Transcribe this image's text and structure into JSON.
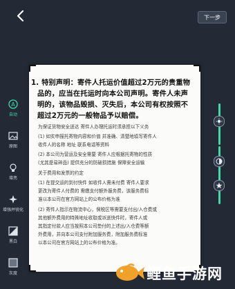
{
  "header": {
    "back_glyph": "‹",
    "next_label": "下一步"
  },
  "toolbar": {
    "accent": "#41d9a7",
    "items": [
      {
        "label": "自动",
        "icon": "auto-a-icon"
      },
      {
        "label": "原图",
        "icon": "image-icon"
      },
      {
        "label": "增亮",
        "icon": "bulb-icon"
      },
      {
        "label": "增强并锐化",
        "icon": "sharpen-icon"
      },
      {
        "label": "黑白",
        "icon": "black-white-icon"
      },
      {
        "label": "灰度",
        "icon": "grayscale-icon"
      }
    ]
  },
  "document": {
    "heading_lines": [
      "1. 特别声明：寄件人托运价值超过2万元的贵重物",
      "品的，应当在托运时向本公司声明。寄件人未声",
      "明的，该物品毁损、灭失后，本公司有权按照不",
      "超过2万元的一般物品予以赔偿。"
    ],
    "body_lines": [
      "为保证货物安全送达  寄件人办理托运时须承担以下义务",
      "(1)  如实申报托寄物内容和价值  并准确、清楚地填写寄件人",
      "      收件人的名称  地址  联系电话等资料",
      "(2)  本公司为营运及安全需要  寄件人应根据托寄物的性质",
      "      (尤其是易碎品)  提供充分的防破损措施  保障安全运输",
      "关于费用和发票的约定",
      "(1)  在提交运的到付快件  如收件人需未付费  寄件人要求",
      "      更改为寄件人付费的  需缴支付额外服务费，该服务费标",
      "      准以本公司在官方网站上的公布价格为准",
      "(2)  寄件人指示在物流中心，保税区等需要支付出/入仓费或",
      "      其他额外费用的特殊地址收取或派送快件时，寄件人或",
      "      其指定付款人应当按照本公司垫付的上述出/入仓费等额",
      "      外费用，并向本公司支付附加服务费，附加服务费标准",
      "      以本公司在官方网站上的公布价格为准。"
    ]
  },
  "sliders": {
    "icons": [
      "brightness-icon",
      "contrast-icon",
      "saturation-icon"
    ],
    "track_color": "#41d9a7"
  },
  "watermark": {
    "text": "鲤鱼手游网",
    "logo": "fish-logo-icon",
    "logo_color": "#f0a12a"
  }
}
